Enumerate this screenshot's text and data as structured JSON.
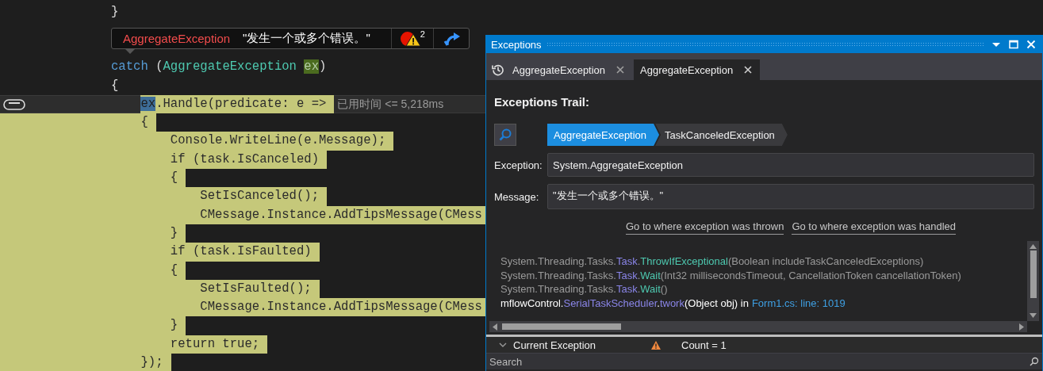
{
  "editor": {
    "lines_above": [
      {
        "selected": false,
        "current": false,
        "segments": [
          {
            "kind": "plain",
            "text": "}"
          }
        ]
      }
    ],
    "datatip": {
      "exception_type": "AggregateException",
      "message": "\"发生一个或多个错误。\"",
      "count": "2"
    },
    "lines": [
      {
        "selected": false,
        "current": false,
        "segments": [
          {
            "kind": "keyword",
            "text": "catch"
          },
          {
            "kind": "plain",
            "text": " ("
          },
          {
            "kind": "type",
            "text": "AggregateException "
          },
          {
            "kind": "ref",
            "text": "ex"
          },
          {
            "kind": "plain",
            "text": ")"
          }
        ]
      },
      {
        "selected": false,
        "current": false,
        "segments": [
          {
            "kind": "plain",
            "text": "{"
          }
        ],
        "children": [
          {
            "selected": true,
            "current": true,
            "annotation": "已用时间 <= 5,218ms",
            "segments": [
              {
                "kind": "cursor",
                "text": "ex"
              },
              {
                "kind": "plain",
                "text": ".Handle(predicate: e =>"
              }
            ]
          },
          {
            "selected": true,
            "current": false,
            "segments": [
              {
                "kind": "plain",
                "text": "{"
              }
            ],
            "children": [
              {
                "selected": true,
                "current": false,
                "segments": [
                  {
                    "kind": "plain",
                    "text": "Console.WriteLine(e.Message);"
                  }
                ]
              },
              {
                "selected": true,
                "current": false,
                "segments": [
                  {
                    "kind": "plain",
                    "text": "if (task.IsCanceled)"
                  }
                ]
              },
              {
                "selected": true,
                "current": false,
                "segments": [
                  {
                    "kind": "plain",
                    "text": "{"
                  }
                ],
                "children": [
                  {
                    "selected": true,
                    "current": false,
                    "segments": [
                      {
                        "kind": "plain",
                        "text": "SetIsCanceled();"
                      }
                    ]
                  },
                  {
                    "selected": true,
                    "current": false,
                    "segments": [
                      {
                        "kind": "plain",
                        "text": "CMessage.Instance.AddTipsMessage(CMess"
                      }
                    ]
                  }
                ]
              },
              {
                "selected": true,
                "current": false,
                "segments": [
                  {
                    "kind": "plain",
                    "text": "}"
                  }
                ]
              },
              {
                "selected": true,
                "current": false,
                "segments": [
                  {
                    "kind": "plain",
                    "text": "if (task.IsFaulted)"
                  }
                ]
              },
              {
                "selected": true,
                "current": false,
                "segments": [
                  {
                    "kind": "plain",
                    "text": "{"
                  }
                ],
                "children": [
                  {
                    "selected": true,
                    "current": false,
                    "segments": [
                      {
                        "kind": "plain",
                        "text": "SetIsFaulted();"
                      }
                    ]
                  },
                  {
                    "selected": true,
                    "current": false,
                    "segments": [
                      {
                        "kind": "plain",
                        "text": "CMessage.Instance.AddTipsMessage(CMess"
                      }
                    ]
                  }
                ]
              },
              {
                "selected": true,
                "current": false,
                "segments": [
                  {
                    "kind": "plain",
                    "text": "}"
                  }
                ]
              },
              {
                "selected": true,
                "current": false,
                "segments": [
                  {
                    "kind": "plain",
                    "text": "return true;"
                  }
                ]
              }
            ]
          },
          {
            "selected": true,
            "current": false,
            "segments": [
              {
                "kind": "plain",
                "text": "});"
              }
            ]
          }
        ]
      }
    ]
  },
  "panel": {
    "title": "Exceptions",
    "tabs": [
      {
        "kind": "history",
        "label": "AggregateException",
        "selected": false
      },
      {
        "kind": "plain",
        "label": "AggregateException",
        "selected": true
      }
    ],
    "trail_heading": "Exceptions Trail:",
    "trail": [
      {
        "label": "AggregateException",
        "selected": true
      },
      {
        "label": "TaskCanceledException",
        "selected": false
      }
    ],
    "fields": [
      {
        "label": "Exception:",
        "value": "System.AggregateException"
      },
      {
        "label": "Message:",
        "value": "\"发生一个或多个错误。\""
      }
    ],
    "links": [
      "Go to where exception was thrown",
      "Go to where exception was handled"
    ],
    "stack": [
      {
        "current": false,
        "segments": [
          {
            "kind": "ns",
            "text": "System.Threading.Tasks."
          },
          {
            "kind": "type",
            "text": "Task"
          },
          {
            "kind": "ns",
            "text": "."
          },
          {
            "kind": "method",
            "text": "ThrowIfExceptional"
          },
          {
            "kind": "args",
            "text": "(Boolean includeTaskCanceledExceptions)"
          }
        ]
      },
      {
        "current": false,
        "segments": [
          {
            "kind": "ns",
            "text": "System.Threading.Tasks."
          },
          {
            "kind": "type",
            "text": "Task"
          },
          {
            "kind": "ns",
            "text": "."
          },
          {
            "kind": "method",
            "text": "Wait"
          },
          {
            "kind": "args",
            "text": "(Int32 millisecondsTimeout, CancellationToken cancellationToken)"
          }
        ]
      },
      {
        "current": false,
        "segments": [
          {
            "kind": "ns",
            "text": "System.Threading.Tasks."
          },
          {
            "kind": "type",
            "text": "Task"
          },
          {
            "kind": "ns",
            "text": "."
          },
          {
            "kind": "method",
            "text": "Wait"
          },
          {
            "kind": "args",
            "text": "()"
          }
        ]
      },
      {
        "current": true,
        "segments": [
          {
            "kind": "ns",
            "text": "mflowControl."
          },
          {
            "kind": "type",
            "text": "SerialTaskScheduler"
          },
          {
            "kind": "ns",
            "text": "."
          },
          {
            "kind": "type",
            "text": "twork"
          },
          {
            "kind": "args",
            "text": "(Object obj) in"
          },
          {
            "kind": "link",
            "text": "Form1.cs: line: 1019"
          }
        ]
      }
    ],
    "tree": [
      {
        "label": "Current Exception",
        "expanded": true,
        "value": "Count = 1"
      }
    ],
    "search": {
      "placeholder": "Search"
    }
  }
}
